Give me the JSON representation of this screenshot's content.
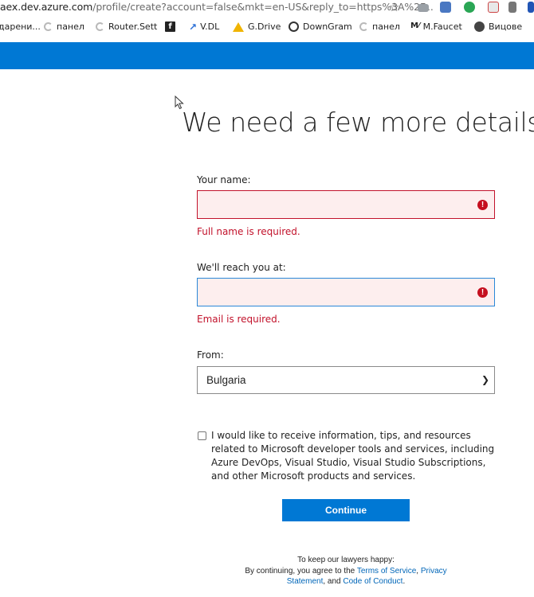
{
  "browser": {
    "url_host": "aex.dev.azure.com",
    "url_rest": "/profile/create?account=false&mkt=en-US&reply_to=https%3A%2F...",
    "bookmarks": [
      {
        "label": "дарени...",
        "icon": "none"
      },
      {
        "label": "панел",
        "icon": "swirl"
      },
      {
        "label": "Router.Sett",
        "icon": "swirl"
      },
      {
        "label": "",
        "icon": "facebook-square"
      },
      {
        "label": "V.DL",
        "icon": "vdl"
      },
      {
        "label": "G.Drive",
        "icon": "google-drive"
      },
      {
        "label": "DownGram",
        "icon": "instagram"
      },
      {
        "label": "панел",
        "icon": "swirl"
      },
      {
        "label": "M.Faucet",
        "icon": "mf"
      },
      {
        "label": "Вицове",
        "icon": "globe"
      }
    ]
  },
  "page": {
    "title": "We need a few more details",
    "name_label": "Your name:",
    "name_value": "",
    "name_error": "Full name is required.",
    "email_label": "We'll reach you at:",
    "email_value": "",
    "email_error": "Email is required.",
    "from_label": "From:",
    "from_value": "Bulgaria",
    "consent_text": "I would like to receive information, tips, and resources related to Microsoft developer tools and services, including Azure DevOps, Visual Studio, Visual Studio Subscriptions, and other Microsoft products and services.",
    "consent_checked": false,
    "continue_label": "Continue",
    "legal_line1": "To keep our lawyers happy:",
    "legal_line2_prefix": "By continuing, you agree to the ",
    "terms_link": "Terms of Service",
    "legal_sep": ", ",
    "privacy_link": "Privacy Statement",
    "legal_and": ", and ",
    "conduct_link": "Code of Conduct",
    "legal_end": "."
  },
  "colors": {
    "brand_blue": "#0078d4",
    "error_red": "#c2122b",
    "error_fill": "#fdeeee",
    "link_blue": "#0066b8"
  }
}
